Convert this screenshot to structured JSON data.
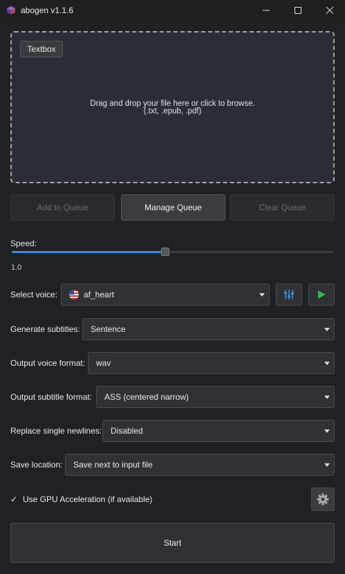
{
  "window": {
    "title": "abogen v1.1.6",
    "icons": {
      "app": "app-cube-icon",
      "minimize": "minimize-icon",
      "maximize": "maximize-icon",
      "close": "close-icon"
    }
  },
  "dropzone": {
    "textbox_label": "Textbox",
    "line1": "Drag and drop your file here or click to browse.",
    "line2": "(.txt, .epub, .pdf)"
  },
  "queue": {
    "add_label": "Add to Queue",
    "manage_label": "Manage Queue",
    "clear_label": "Clear Queue"
  },
  "speed": {
    "label": "Speed:",
    "value": "1.0",
    "fraction": 0.476
  },
  "voice": {
    "label": "Select voice:",
    "selected": "af_heart",
    "flag_icon": "us-flag-icon",
    "mixer_icon": "voice-mixer-icon",
    "play_icon": "play-icon"
  },
  "subtitles": {
    "label": "Generate subtitles:",
    "selected": "Sentence"
  },
  "voice_format": {
    "label": "Output voice format:",
    "selected": "wav"
  },
  "subtitle_format": {
    "label": "Output subtitle format:",
    "selected": "ASS (centered narrow)"
  },
  "newlines": {
    "label": "Replace single newlines:",
    "selected": "Disabled"
  },
  "save_location": {
    "label": "Save location:",
    "selected": "Save next to input file"
  },
  "gpu": {
    "checked": true,
    "label": "Use GPU Acceleration (if available)",
    "check_glyph": "✓"
  },
  "settings_icon": "gear-icon",
  "start_label": "Start",
  "colors": {
    "background": "#202124",
    "accent": "#3a8fd9",
    "play_green": "#2fb84a",
    "mixer_blue": "#3a8fd9"
  }
}
